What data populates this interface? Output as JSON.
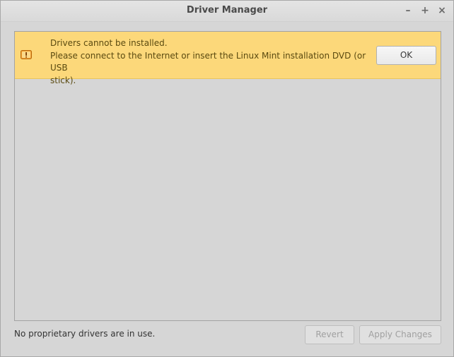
{
  "window": {
    "title": "Driver Manager",
    "controls": {
      "minimize": "–",
      "maximize": "+",
      "close": "×"
    }
  },
  "infobar": {
    "icon": "warning-icon",
    "line1": "Drivers cannot be installed.",
    "line2": "Please connect to the Internet or insert the Linux Mint installation DVD (or USB",
    "line3": "stick).",
    "ok_label": "OK",
    "background": "#fcd87a"
  },
  "footer": {
    "status": "No proprietary drivers are in use.",
    "revert_label": "Revert",
    "apply_label": "Apply Changes"
  }
}
